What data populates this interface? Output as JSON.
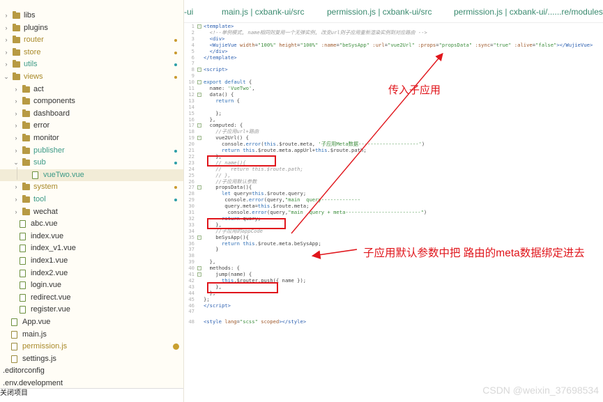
{
  "sidebar": {
    "items": [
      {
        "label": "libs",
        "type": "folder",
        "level": 0,
        "expanded": false,
        "color": "normal",
        "marker": ""
      },
      {
        "label": "plugins",
        "type": "folder",
        "level": 0,
        "expanded": false,
        "color": "normal",
        "marker": ""
      },
      {
        "label": "router",
        "type": "folder",
        "level": 0,
        "expanded": false,
        "color": "yellow",
        "marker": "dot-yellow"
      },
      {
        "label": "store",
        "type": "folder",
        "level": 0,
        "expanded": false,
        "color": "yellow",
        "marker": "dot-yellow"
      },
      {
        "label": "utils",
        "type": "folder",
        "level": 0,
        "expanded": false,
        "color": "green",
        "marker": "dot-teal"
      },
      {
        "label": "views",
        "type": "folder",
        "level": 0,
        "expanded": true,
        "color": "yellow",
        "marker": "dot-yellow"
      },
      {
        "label": "act",
        "type": "folder",
        "level": 1,
        "expanded": false,
        "color": "normal",
        "marker": ""
      },
      {
        "label": "components",
        "type": "folder",
        "level": 1,
        "expanded": false,
        "color": "normal",
        "marker": ""
      },
      {
        "label": "dashboard",
        "type": "folder",
        "level": 1,
        "expanded": false,
        "color": "normal",
        "marker": ""
      },
      {
        "label": "error",
        "type": "folder",
        "level": 1,
        "expanded": false,
        "color": "normal",
        "marker": ""
      },
      {
        "label": "monitor",
        "type": "folder",
        "level": 1,
        "expanded": false,
        "color": "normal",
        "marker": ""
      },
      {
        "label": "publisher",
        "type": "folder",
        "level": 1,
        "expanded": false,
        "color": "green",
        "marker": "dot-teal"
      },
      {
        "label": "sub",
        "type": "folder",
        "level": 1,
        "expanded": true,
        "color": "green",
        "marker": "dot-teal"
      },
      {
        "label": "vueTwo.vue",
        "type": "vue",
        "level": 2,
        "expanded": false,
        "color": "green",
        "marker": "",
        "selected": true
      },
      {
        "label": "system",
        "type": "folder",
        "level": 1,
        "expanded": false,
        "color": "yellow",
        "marker": "dot-yellow"
      },
      {
        "label": "tool",
        "type": "folder",
        "level": 1,
        "expanded": false,
        "color": "green",
        "marker": "dot-teal"
      },
      {
        "label": "wechat",
        "type": "folder",
        "level": 1,
        "expanded": false,
        "color": "normal",
        "marker": ""
      },
      {
        "label": "abc.vue",
        "type": "vue",
        "level": 1,
        "expanded": false,
        "color": "normal",
        "marker": ""
      },
      {
        "label": "index.vue",
        "type": "vue",
        "level": 1,
        "expanded": false,
        "color": "normal",
        "marker": ""
      },
      {
        "label": "index_v1.vue",
        "type": "vue",
        "level": 1,
        "expanded": false,
        "color": "normal",
        "marker": ""
      },
      {
        "label": "index1.vue",
        "type": "vue",
        "level": 1,
        "expanded": false,
        "color": "normal",
        "marker": ""
      },
      {
        "label": "index2.vue",
        "type": "vue",
        "level": 1,
        "expanded": false,
        "color": "normal",
        "marker": ""
      },
      {
        "label": "login.vue",
        "type": "vue",
        "level": 1,
        "expanded": false,
        "color": "normal",
        "marker": ""
      },
      {
        "label": "redirect.vue",
        "type": "vue",
        "level": 1,
        "expanded": false,
        "color": "normal",
        "marker": ""
      },
      {
        "label": "register.vue",
        "type": "vue",
        "level": 1,
        "expanded": false,
        "color": "normal",
        "marker": ""
      },
      {
        "label": "App.vue",
        "type": "vue",
        "level": 0,
        "expanded": false,
        "color": "normal",
        "marker": ""
      },
      {
        "label": "main.js",
        "type": "js",
        "level": 0,
        "expanded": false,
        "color": "normal",
        "marker": ""
      },
      {
        "label": "permission.js",
        "type": "js",
        "level": 0,
        "expanded": false,
        "color": "yellow",
        "marker": "badge"
      },
      {
        "label": "settings.js",
        "type": "js",
        "level": 0,
        "expanded": false,
        "color": "normal",
        "marker": ""
      },
      {
        "label": ".editorconfig",
        "type": "file",
        "level": -1,
        "expanded": false,
        "color": "normal",
        "marker": ""
      },
      {
        "label": ".env.development",
        "type": "file",
        "level": -1,
        "expanded": false,
        "color": "normal",
        "marker": ""
      }
    ],
    "close_project": "关闭项目"
  },
  "tabs": [
    {
      "label": "-ui"
    },
    {
      "label": "main.js | cxbank-ui/src"
    },
    {
      "label": "permission.js | cxbank-ui/src"
    },
    {
      "label": "permission.js | cxbank-ui/......re/modules"
    }
  ],
  "editor": {
    "lines": [
      {
        "n": "1",
        "fold": "-",
        "html": "<span class='tag'>&lt;template&gt;</span>"
      },
      {
        "n": "2",
        "fold": "",
        "html": "  <span class='cmt'>&lt;!--单例模式, name相同则复用一个无弹实例, 改变url则子应用重新渲染实例到对应路由 --&gt;</span>"
      },
      {
        "n": "3",
        "fold": "",
        "html": "  <span class='tag'>&lt;div&gt;</span>"
      },
      {
        "n": "4",
        "fold": "",
        "html": "  <span class='tag'>&lt;WujieVue</span> <span class='attr'>width</span>=<span class='str'>\"100%\"</span> <span class='attr'>height</span>=<span class='str'>\"100%\"</span> <span class='attr'>:name</span>=<span class='str'>\"beSysApp\"</span> <span class='attr'>:url</span>=<span class='str'>\"vue2Url\"</span> <span class='attr'>:props</span>=<span class='str'>\"propsData\"</span> <span class='attr'>:sync</span>=<span class='str'>\"true\"</span> <span class='attr'>:alive</span>=<span class='str'>\"false\"</span><span class='tag'>&gt;&lt;/WujieVue&gt;</span>"
      },
      {
        "n": "5",
        "fold": "",
        "html": "  <span class='tag'>&lt;/div&gt;</span>"
      },
      {
        "n": "6",
        "fold": "",
        "html": "<span class='tag'>&lt;/template&gt;</span>"
      },
      {
        "n": "7",
        "fold": "",
        "html": ""
      },
      {
        "n": "8",
        "fold": "-",
        "html": "<span class='tag'>&lt;script&gt;</span>"
      },
      {
        "n": "9",
        "fold": "",
        "html": ""
      },
      {
        "n": "10",
        "fold": "-",
        "html": "<span class='kw'>export default</span> {"
      },
      {
        "n": "11",
        "fold": "",
        "html": "  name: <span class='str'>'VueTwo'</span>,"
      },
      {
        "n": "12",
        "fold": "-",
        "html": "  data() {"
      },
      {
        "n": "13",
        "fold": "",
        "html": "    <span class='kw'>return</span> {"
      },
      {
        "n": "14",
        "fold": "",
        "html": ""
      },
      {
        "n": "15",
        "fold": "",
        "html": "    };"
      },
      {
        "n": "16",
        "fold": "",
        "html": "  },"
      },
      {
        "n": "17",
        "fold": "-",
        "html": "  computed: {"
      },
      {
        "n": "18",
        "fold": "",
        "html": "    <span class='cmt'>//子应用url+路由</span>"
      },
      {
        "n": "19",
        "fold": "-",
        "html": "    vue2Url() {"
      },
      {
        "n": "20",
        "fold": "",
        "html": "      console.<span class='kw'>error</span>(<span class='kw'>this</span>.$route.meta, <span class='str'>'子应用Meta数据--------------------'</span>)"
      },
      {
        "n": "21",
        "fold": "",
        "html": "      <span class='kw'>return this</span>.$route.meta.appUrl+<span class='kw'>this</span>.$route.path;"
      },
      {
        "n": "22",
        "fold": "",
        "html": "    },"
      },
      {
        "n": "23",
        "fold": "",
        "html": "    <span class='cmt'>// name(){</span>"
      },
      {
        "n": "24",
        "fold": "",
        "html": "    <span class='cmt'>//   return this.$route.path;</span>"
      },
      {
        "n": "25",
        "fold": "",
        "html": "    <span class='cmt'>// },</span>"
      },
      {
        "n": "26",
        "fold": "",
        "html": "    <span class='cmt'>//子应用默认参数</span>"
      },
      {
        "n": "27",
        "fold": "-",
        "html": "    propsData(){"
      },
      {
        "n": "28",
        "fold": "",
        "html": "      <span class='kw'>let</span> query=<span class='kw'>this</span>.$route.query;"
      },
      {
        "n": "29",
        "fold": "",
        "html": "       console.<span class='kw'>error</span>(query,<span class='str'>\"main  query-------------</span>"
      },
      {
        "n": "30",
        "fold": "",
        "html": "       query.meta=<span class='kw'>this</span>.$route.meta;"
      },
      {
        "n": "31",
        "fold": "",
        "html": "        console.<span class='kw'>error</span>(query,<span class='str'>\"main  query + meta-------------------------\"</span>)"
      },
      {
        "n": "32",
        "fold": "",
        "html": "      <span class='kw'>return</span> query;"
      },
      {
        "n": "33",
        "fold": "",
        "html": "    },"
      },
      {
        "n": "34",
        "fold": "",
        "html": "    <span class='cmt'>//子应用的appCode</span>"
      },
      {
        "n": "35",
        "fold": "-",
        "html": "    beSysApp(){"
      },
      {
        "n": "36",
        "fold": "",
        "html": "      <span class='kw'>return this</span>.$route.meta.beSysApp;"
      },
      {
        "n": "37",
        "fold": "",
        "html": "    }"
      },
      {
        "n": "38",
        "fold": "",
        "html": ""
      },
      {
        "n": "39",
        "fold": "",
        "html": "  },"
      },
      {
        "n": "40",
        "fold": "-",
        "html": "  methods: {"
      },
      {
        "n": "41",
        "fold": "-",
        "html": "    jump(name) {"
      },
      {
        "n": "42",
        "fold": "",
        "html": "      <span class='kw'>this</span>.$router.push({ name });"
      },
      {
        "n": "43",
        "fold": "",
        "html": "    },"
      },
      {
        "n": "44",
        "fold": "",
        "html": "  },"
      },
      {
        "n": "45",
        "fold": "",
        "html": "};"
      },
      {
        "n": "46",
        "fold": "",
        "html": "<span class='tag'>&lt;/script&gt;</span>"
      },
      {
        "n": "47",
        "fold": "",
        "html": ""
      },
      {
        "n": "48",
        "fold": "",
        "html": "<span class='tag'>&lt;style</span> <span class='attr'>lang</span>=<span class='str'>\"scss\"</span> <span class='attr'>scoped</span><span class='tag'>&gt;&lt;/style&gt;</span>"
      }
    ]
  },
  "annotations": {
    "pass_to_child": "传入子应用",
    "bind_meta": "子应用默认参数中把 路由的meta数据绑定进去",
    "color": "#e0151b"
  },
  "watermark": "CSDN @weixin_37698534"
}
